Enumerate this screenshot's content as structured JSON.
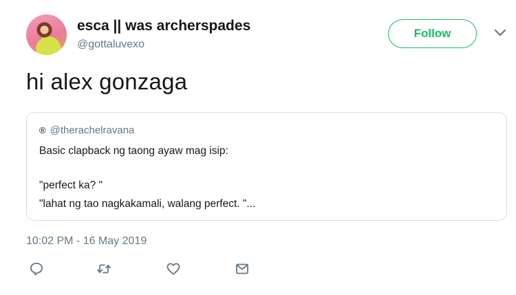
{
  "tweet": {
    "display_name": "esca || was archerspades",
    "handle": "@gottaluvexo",
    "follow_label": "Follow",
    "text": "hi alex gonzaga",
    "timestamp": "10:02 PM - 16 May 2019"
  },
  "quoted_tweet": {
    "badge": "®",
    "handle": "@therachelravana",
    "lines": [
      "Basic clapback ng taong ayaw mag isip:",
      "\"perfect ka? \"",
      "\"lahat ng tao nagkakamali, walang perfect. \"..."
    ]
  },
  "actions": [
    "reply-icon",
    "retweet-icon",
    "like-icon",
    "dm-icon"
  ],
  "colors": {
    "follow_green": "#17bf63",
    "muted_text": "#657786",
    "border": "#d6dee4",
    "text": "#14171a"
  }
}
